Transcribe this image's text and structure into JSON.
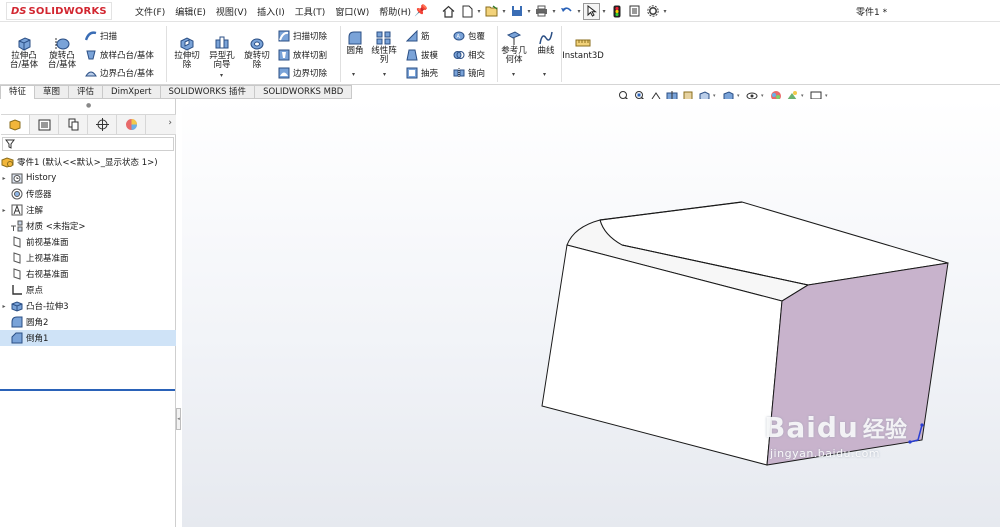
{
  "app": {
    "logo_ds": "DS",
    "logo_text": "SOLIDWORKS",
    "document_title": "零件1 *",
    "brand_color": "#d22630"
  },
  "menu": [
    "文件(F)",
    "编辑(E)",
    "视图(V)",
    "插入(I)",
    "工具(T)",
    "窗口(W)",
    "帮助(H)"
  ],
  "quick_access_icons": [
    "home-icon",
    "new-icon",
    "open-icon",
    "save-icon",
    "print-icon",
    "undo-icon",
    "select-icon",
    "rebuild-icon",
    "file-properties-icon",
    "options-icon"
  ],
  "ribbon": {
    "extrude_boss": "拉伸凸\n台/基体",
    "revolve_boss": "旋转凸\n台/基体",
    "sweep": "扫描",
    "loft_boss": "放样凸台/基体",
    "boundary_boss": "边界凸台/基体",
    "extrude_cut": "拉伸切\n除",
    "hole_wizard": "异型孔\n向导",
    "revolve_cut": "旋转切\n除",
    "swept_cut": "扫描切除",
    "lofted_cut": "放样切割",
    "boundary_cut": "边界切除",
    "fillet": "圆角",
    "linear_pattern": "线性阵\n列",
    "rib": "筋",
    "draft": "拔模",
    "shell": "抽壳",
    "wrap": "包覆",
    "intersect": "相交",
    "mirror": "镜向",
    "reference_geometry": "参考几\n何体",
    "curves": "曲线",
    "instant3d": "Instant3D"
  },
  "tabs": [
    "特征",
    "草图",
    "评估",
    "DimXpert",
    "SOLIDWORKS 插件",
    "SOLIDWORKS MBD"
  ],
  "feature_tree": {
    "root": "零件1 (默认<<默认>_显示状态 1>)",
    "items": [
      {
        "label": "History",
        "icon": "history-folder-icon",
        "expandable": true
      },
      {
        "label": "传感器",
        "icon": "sensor-icon",
        "expandable": false
      },
      {
        "label": "注解",
        "icon": "annotation-icon",
        "expandable": true
      },
      {
        "label": "材质 <未指定>",
        "icon": "material-icon",
        "expandable": false
      },
      {
        "label": "前视基准面",
        "icon": "plane-icon",
        "expandable": false
      },
      {
        "label": "上视基准面",
        "icon": "plane-icon",
        "expandable": false
      },
      {
        "label": "右视基准面",
        "icon": "plane-icon",
        "expandable": false
      },
      {
        "label": "原点",
        "icon": "origin-icon",
        "expandable": false
      },
      {
        "label": "凸台-拉伸3",
        "icon": "extrude-feature-icon",
        "expandable": true
      },
      {
        "label": "圆角2",
        "icon": "fillet-feature-icon",
        "expandable": false
      },
      {
        "label": "倒角1",
        "icon": "chamfer-feature-icon",
        "expandable": false,
        "selected": true
      }
    ]
  },
  "viewport": {
    "selected_face_color": "#c8b3cc",
    "edge_color": "#1a1a1a",
    "highlight_edge_color": "#2a3fd1"
  },
  "watermark": {
    "brand": "Baidu",
    "suffix": "经验",
    "url": "jingyan.baidu.com"
  }
}
